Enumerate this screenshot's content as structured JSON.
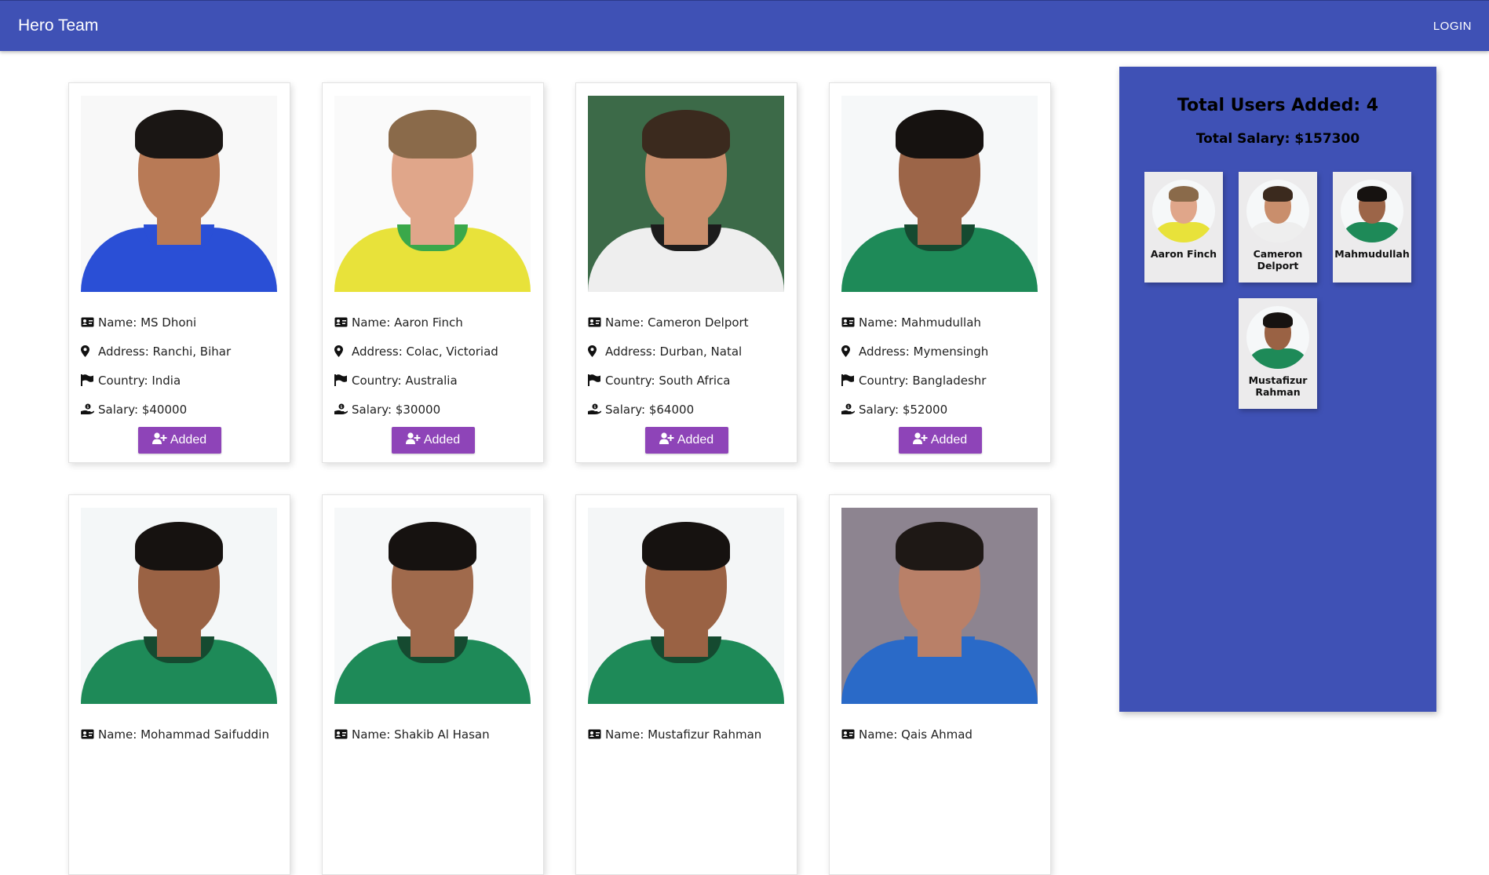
{
  "appbar": {
    "title": "Hero Team",
    "login_label": "LOGIN"
  },
  "players": [
    {
      "name_line": "Name: MS Dhoni",
      "address_line": "Address: Ranchi, Bihar",
      "country_line": "Country: India",
      "salary_line": "Salary: $40000",
      "button_label": "Added",
      "skin": "#b87a56",
      "hair": "#1a1614",
      "shirt": "#2a4fd6",
      "collar": "#2a4fd6",
      "bg": "#f8f8f8"
    },
    {
      "name_line": "Name: Aaron Finch",
      "address_line": "Address: Colac, Victoriad",
      "country_line": "Country: Australia",
      "salary_line": "Salary: $30000",
      "button_label": "Added",
      "skin": "#e0a68a",
      "hair": "#8a6a4a",
      "shirt": "#e8e23a",
      "collar": "#3aa84a",
      "bg": "#fafafa"
    },
    {
      "name_line": "Name: Cameron Delport",
      "address_line": "Address: Durban, Natal",
      "country_line": "Country: South Africa",
      "salary_line": "Salary: $64000",
      "button_label": "Added",
      "skin": "#c98e6c",
      "hair": "#3b2a1e",
      "shirt": "#eeeeee",
      "collar": "#1c1c1c",
      "bg": "#3c6a48"
    },
    {
      "name_line": "Name: Mahmudullah",
      "address_line": "Address: Mymensingh",
      "country_line": "Country: Bangladeshr",
      "salary_line": "Salary: $52000",
      "button_label": "Added",
      "skin": "#9c6548",
      "hair": "#161210",
      "shirt": "#1e8a58",
      "collar": "#154a30",
      "bg": "#f6f8f9"
    },
    {
      "name_line": "Name: Mohammad Saifuddin",
      "skin": "#9a6244",
      "hair": "#161210",
      "shirt": "#1e8a58",
      "collar": "#154a30",
      "bg": "#f4f7f8"
    },
    {
      "name_line": "Name: Shakib Al Hasan",
      "skin": "#a06a4c",
      "hair": "#161210",
      "shirt": "#1e8a58",
      "collar": "#154a30",
      "bg": "#f6f8f9"
    },
    {
      "name_line": "Name: Mustafizur Rahman",
      "skin": "#9a6244",
      "hair": "#161210",
      "shirt": "#1e8a58",
      "collar": "#154a30",
      "bg": "#f4f6f7"
    },
    {
      "name_line": "Name: Qais Ahmad",
      "skin": "#b98068",
      "hair": "#1e1815",
      "shirt": "#2a6ac8",
      "collar": "#2a6ac8",
      "bg": "#8d8490"
    }
  ],
  "summary": {
    "total_users": "Total Users Added: 4",
    "total_salary": "Total Salary: $157300",
    "added": [
      {
        "name": "Aaron Finch",
        "skin": "#e0a68a",
        "hair": "#8a6a4a",
        "shirt": "#e8e23a"
      },
      {
        "name": "Cameron Delport",
        "skin": "#c98e6c",
        "hair": "#3b2a1e",
        "shirt": "#eeeeee"
      },
      {
        "name": "Mahmudullah",
        "skin": "#9c6548",
        "hair": "#161210",
        "shirt": "#1e8a58"
      },
      {
        "name": "Mustafizur Rahman",
        "skin": "#9a6244",
        "hair": "#161210",
        "shirt": "#1e8a58"
      }
    ]
  },
  "colors": {
    "primary": "#3f51b5",
    "button": "#8e44b8"
  },
  "icons": {
    "name": "id-card-icon",
    "address": "map-marker-icon",
    "country": "flag-icon",
    "salary": "hand-holding-dollar-icon",
    "add": "user-plus-icon"
  }
}
